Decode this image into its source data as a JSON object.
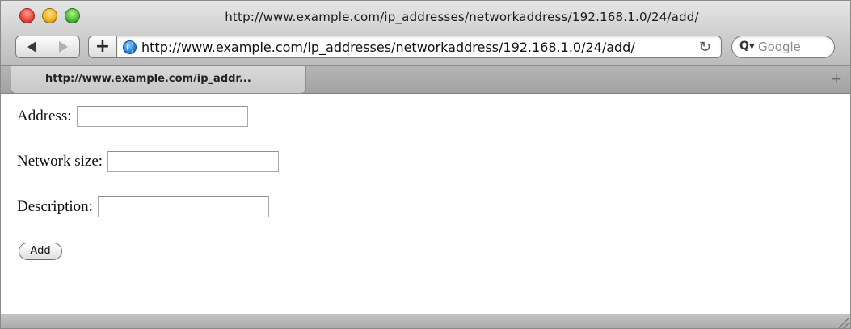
{
  "window": {
    "title": "http://www.example.com/ip_addresses/networkaddress/192.168.1.0/24/add/"
  },
  "toolbar": {
    "back_icon": "back-arrow-icon",
    "forward_icon": "forward-arrow-icon",
    "add_bookmark_label": "+",
    "url": "http://www.example.com/ip_addresses/networkaddress/192.168.1.0/24/add/",
    "reload_glyph": "↻",
    "search_icon_glyph": "Q▾",
    "search_placeholder": "Google"
  },
  "tabs": [
    {
      "label": "http://www.example.com/ip_addr..."
    }
  ],
  "tabbar": {
    "new_tab_glyph": "+"
  },
  "form": {
    "address_label": "Address:",
    "address_value": "",
    "network_size_label": "Network size:",
    "network_size_value": "",
    "description_label": "Description:",
    "description_value": "",
    "submit_label": "Add"
  }
}
